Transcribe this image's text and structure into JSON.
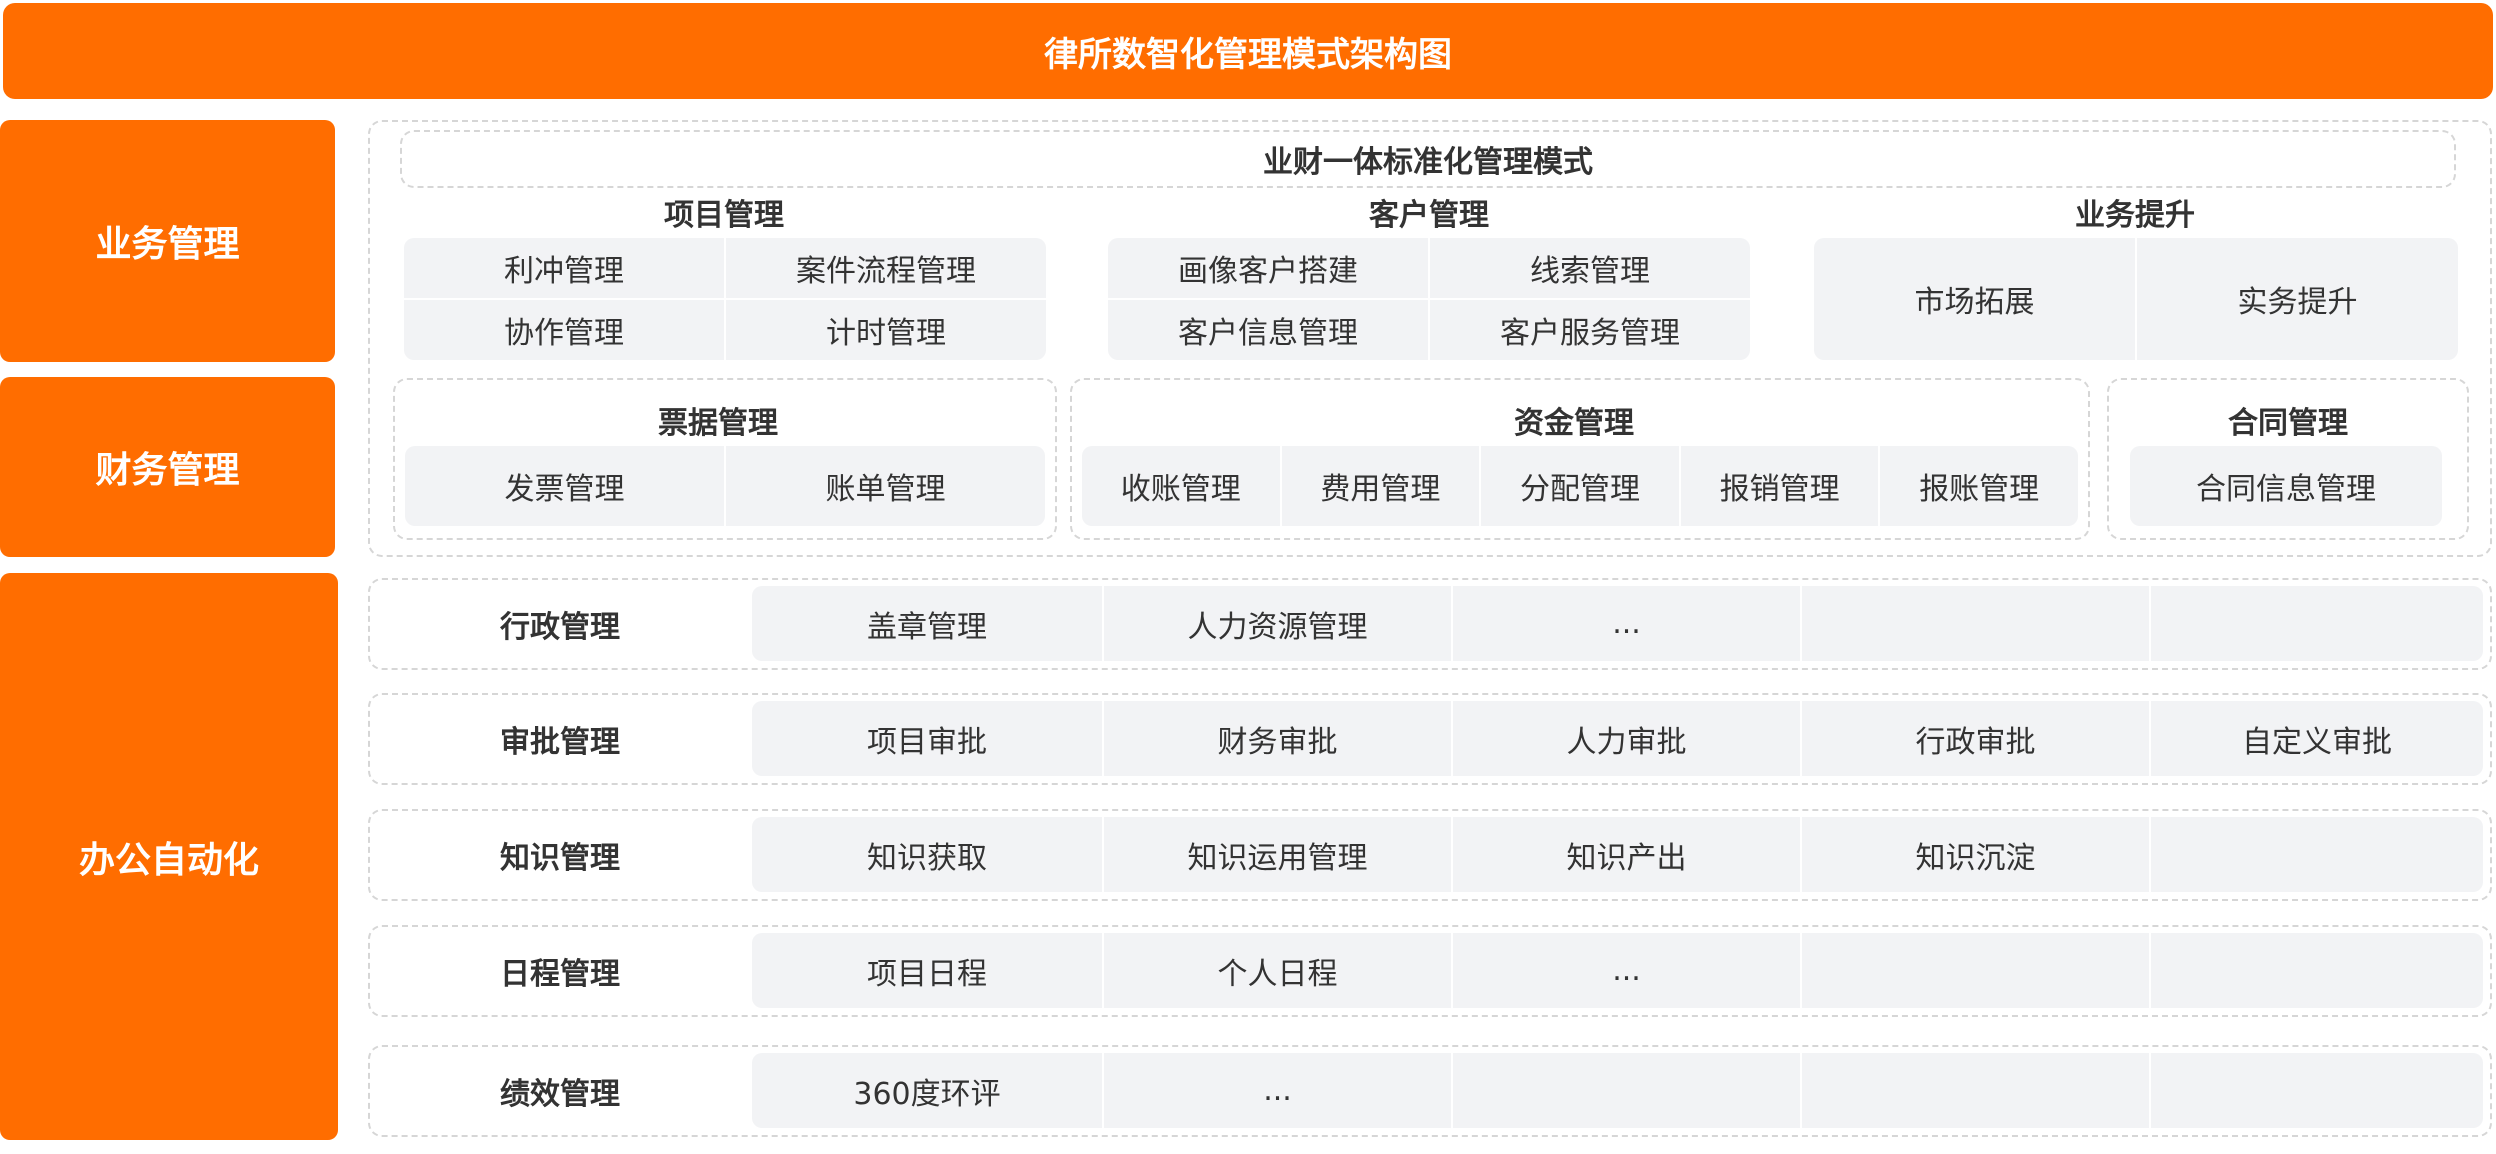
{
  "title": "律所数智化管理模式架构图",
  "categories": {
    "business": "业务管理",
    "finance": "财务管理",
    "office": "办公自动化"
  },
  "business": {
    "banner": "业财一体标准化管理模式",
    "project": {
      "title": "项目管理",
      "items": [
        "利冲管理",
        "案件流程管理",
        "协作管理",
        "计时管理"
      ]
    },
    "client": {
      "title": "客户管理",
      "items": [
        "画像客户搭建",
        "线索管理",
        "客户信息管理",
        "客户服务管理"
      ]
    },
    "improve": {
      "title": "业务提升",
      "items": [
        "市场拓展",
        "实务提升"
      ]
    }
  },
  "finance": {
    "bills": {
      "title": "票据管理",
      "items": [
        "发票管理",
        "账单管理"
      ]
    },
    "funds": {
      "title": "资金管理",
      "items": [
        "收账管理",
        "费用管理",
        "分配管理",
        "报销管理",
        "报账管理"
      ]
    },
    "contract": {
      "title": "合同管理",
      "items": [
        "合同信息管理"
      ]
    }
  },
  "office": {
    "rows": [
      {
        "label": "行政管理",
        "items": [
          "盖章管理",
          "人力资源管理",
          "...",
          "",
          ""
        ]
      },
      {
        "label": "审批管理",
        "items": [
          "项目审批",
          "财务审批",
          "人力审批",
          "行政审批",
          "自定义审批"
        ]
      },
      {
        "label": "知识管理",
        "items": [
          "知识获取",
          "知识运用管理",
          "知识产出",
          "知识沉淀",
          ""
        ]
      },
      {
        "label": "日程管理",
        "items": [
          "项目日程",
          "个人日程",
          "...",
          "",
          ""
        ]
      },
      {
        "label": "绩效管理",
        "items": [
          "360度环评",
          "...",
          "",
          "",
          ""
        ]
      }
    ]
  },
  "colors": {
    "accent": "#FF6D00",
    "cell_bg": "#f2f3f5",
    "dashed_border": "#d6d6d6"
  }
}
